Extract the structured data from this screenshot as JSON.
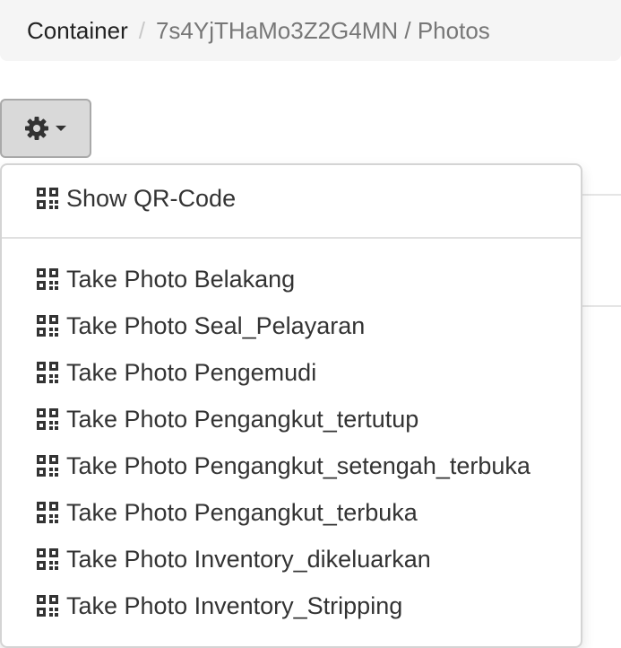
{
  "breadcrumb": {
    "container": "Container",
    "separator": "/",
    "current": "7s4YjTHaMo3Z2G4MN / Photos"
  },
  "toolbar": {
    "gear_icon": "gear-icon",
    "caret_icon": "caret-down-icon"
  },
  "menu": {
    "show_qr": "Show QR-Code",
    "items": [
      "Take Photo Belakang",
      "Take Photo Seal_Pelayaran",
      "Take Photo Pengemudi",
      "Take Photo Pengangkut_tertutup",
      "Take Photo Pengangkut_setengah_terbuka",
      "Take Photo Pengangkut_terbuka",
      "Take Photo Inventory_dikeluarkan",
      "Take Photo Inventory_Stripping"
    ],
    "item_icon": "qrcode-icon"
  }
}
